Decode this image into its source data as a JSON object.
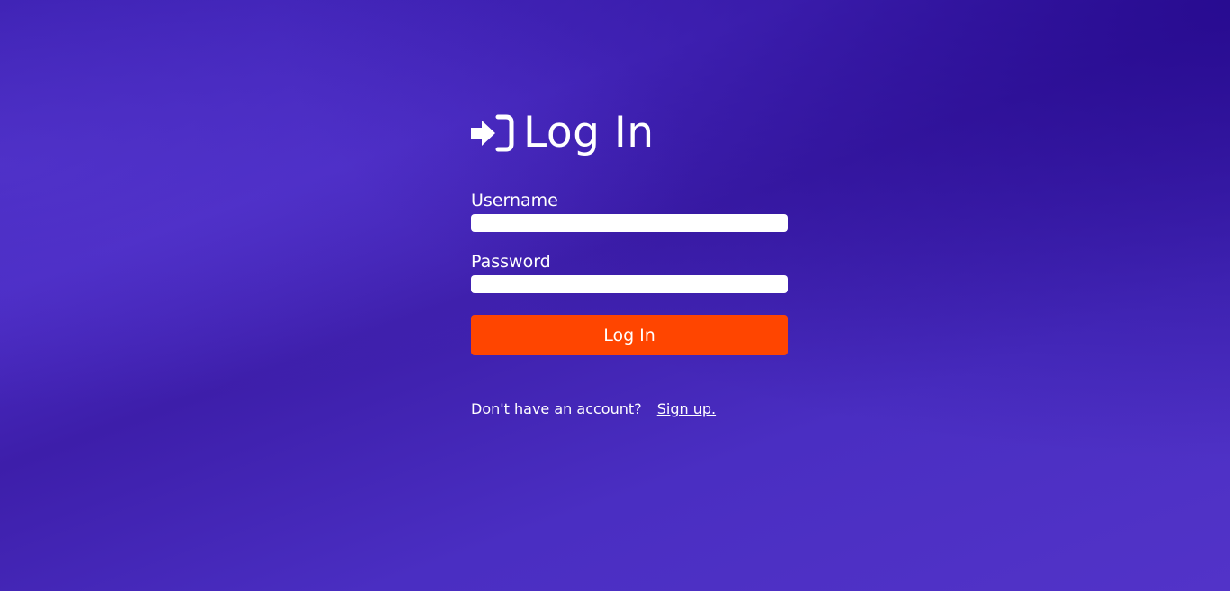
{
  "login": {
    "title": "Log In",
    "title_icon": "sign-in-icon",
    "username_label": "Username",
    "username_value": "",
    "password_label": "Password",
    "password_value": "",
    "submit_label": "Log In",
    "signup_prompt": "Don't have an account?",
    "signup_link": "Sign up."
  },
  "colors": {
    "background": "#4a2ec2",
    "background_dark": "#24088c",
    "button": "#ff4500",
    "text": "#ffffff",
    "input_background": "#ffffff"
  }
}
